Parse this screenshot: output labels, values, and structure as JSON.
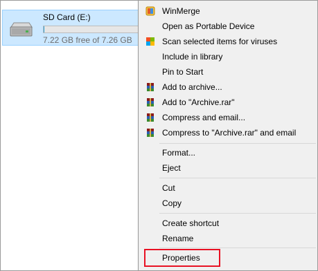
{
  "drive": {
    "name": "SD Card (E:)",
    "free_text": "7.22 GB free of 7.26 GB",
    "used_fraction": 0.0055,
    "icon": "drive-icon"
  },
  "menu": {
    "items": [
      {
        "label": "WinMerge",
        "icon": "winmerge-icon"
      },
      {
        "label": "Open as Portable Device",
        "icon": ""
      },
      {
        "label": "Scan selected items for viruses",
        "icon": "defender-icon"
      },
      {
        "label": "Include in library",
        "icon": ""
      },
      {
        "label": "Pin to Start",
        "icon": ""
      },
      {
        "label": "Add to archive...",
        "icon": "winrar-icon"
      },
      {
        "label": "Add to \"Archive.rar\"",
        "icon": "winrar-icon"
      },
      {
        "label": "Compress and email...",
        "icon": "winrar-icon"
      },
      {
        "label": "Compress to \"Archive.rar\" and email",
        "icon": "winrar-icon"
      },
      {
        "label": "Format...",
        "icon": ""
      },
      {
        "label": "Eject",
        "icon": ""
      },
      {
        "label": "Cut",
        "icon": ""
      },
      {
        "label": "Copy",
        "icon": ""
      },
      {
        "label": "Create shortcut",
        "icon": ""
      },
      {
        "label": "Rename",
        "icon": ""
      },
      {
        "label": "Properties",
        "icon": ""
      }
    ]
  },
  "colors": {
    "selection_bg": "#cce8ff",
    "menu_bg": "#f0f0f0",
    "highlight_border": "#e81123",
    "progress_fill": "#26a0da"
  }
}
